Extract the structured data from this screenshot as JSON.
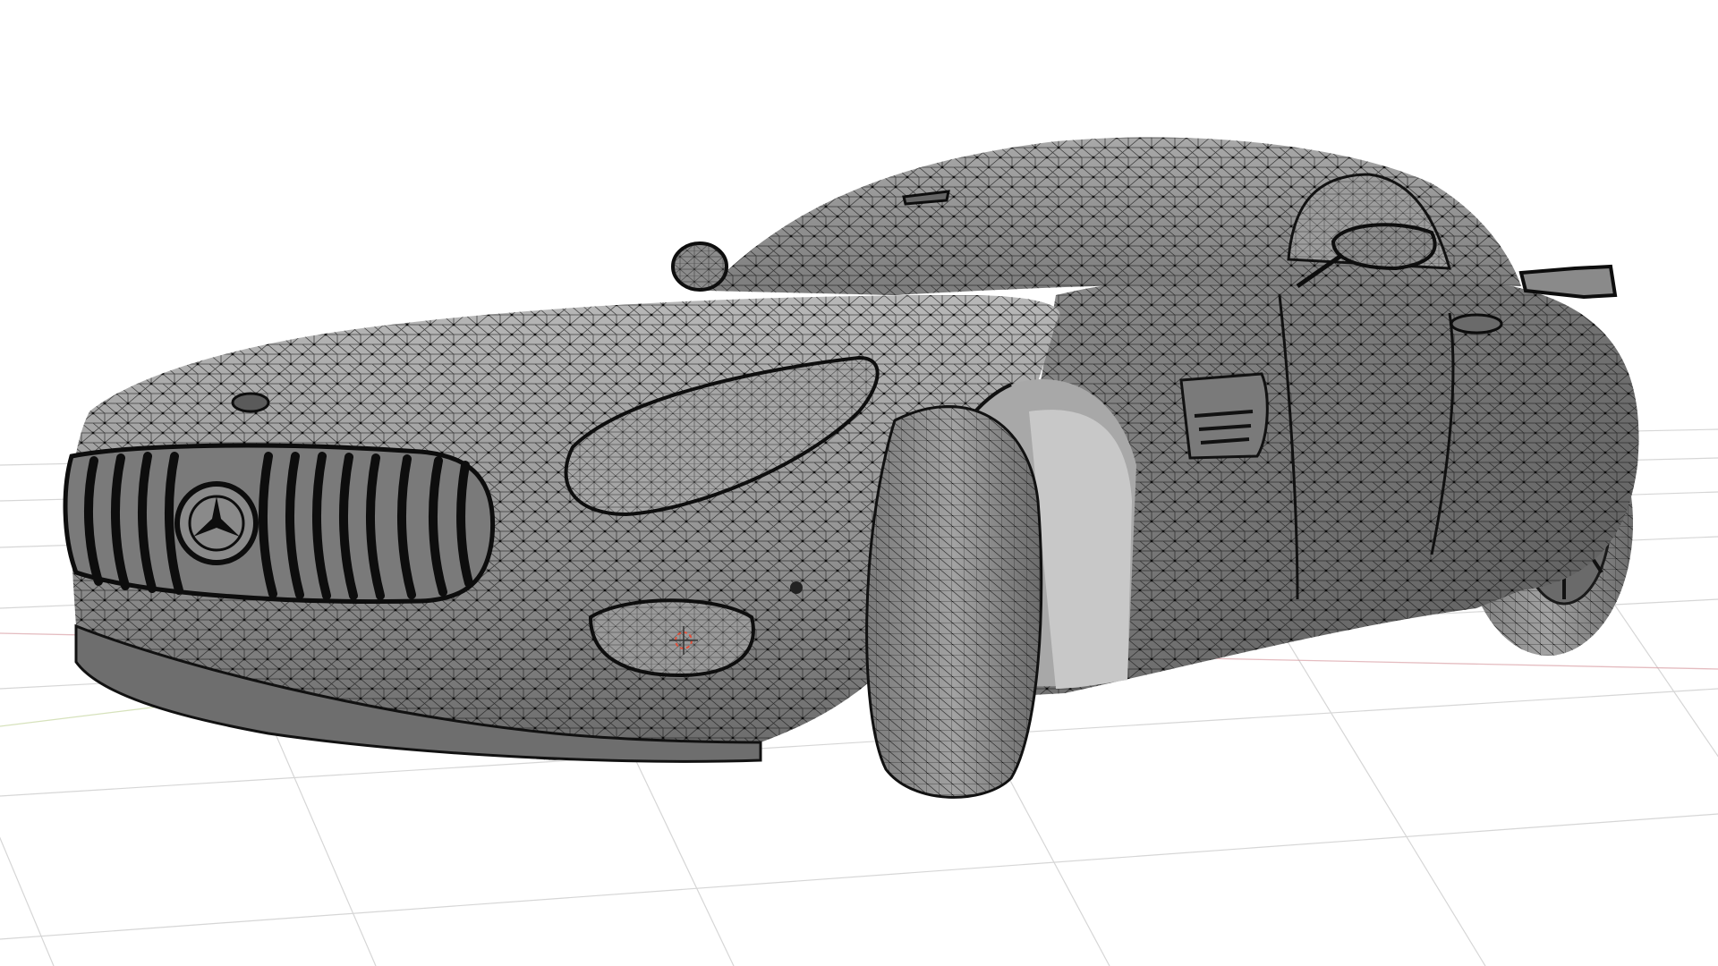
{
  "viewport": {
    "mode": "edit-mode-wireframe-overlay",
    "colors": {
      "background": "#ffffff",
      "grid_line": "#d6d6d6",
      "axis_x": "#d9a0a6",
      "axis_y": "#c6d6a0",
      "mesh_fill": "#8f8f8f",
      "mesh_fill_light": "#b9b9b9",
      "mesh_fill_dark": "#5e5e5e",
      "wire": "#1e1e1e",
      "vertex": "#0d0d0d",
      "cursor_red": "#e0503a"
    },
    "object": {
      "name": "",
      "icon": "3d-cursor-icon"
    }
  }
}
